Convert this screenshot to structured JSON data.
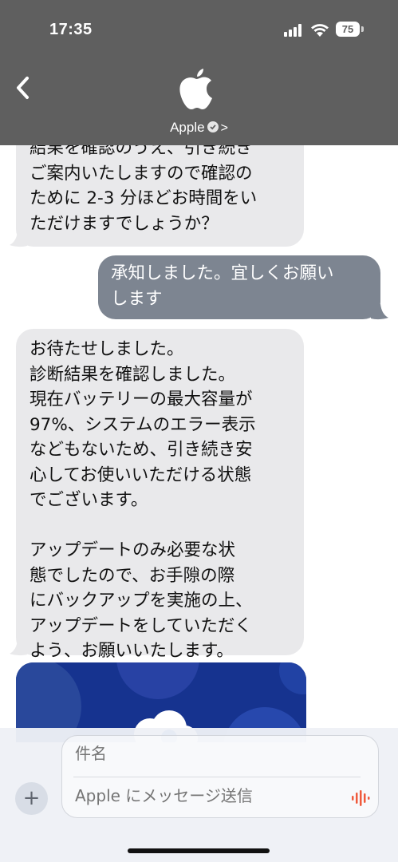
{
  "status_bar": {
    "time": "17:35",
    "battery": "75"
  },
  "header": {
    "contact_name": "Apple",
    "chevron": ">"
  },
  "messages": [
    {
      "from": "received",
      "text": "結果を確認のうえ、引き続き\nご案内いたしますので確認の\nために 2-3 分ほどお時間をい\nただけますでしょうか？"
    },
    {
      "from": "sent",
      "text": "承知しました。宜しくお願い\nします"
    },
    {
      "from": "received",
      "text": "お待たせしました。\n診断結果を確認しました。\n現在バッテリーの最大容量が\n97%、システムのエラー表示\nなどもないため、引き続き安\n心してお使いいただける状態\nでございます。\n\nアップデートのみ必要な状\n態でしたので、お手隙の際\nにバックアップを実施の上、\nアップデートをしていただく\nよう、お願いいたします。"
    }
  ],
  "composer": {
    "subject_placeholder": "件名",
    "message_placeholder": "Apple にメッセージ送信",
    "plus": "+"
  },
  "colors": {
    "header_bg": "#5f5f5f",
    "received_bubble": "#e9e9eb",
    "sent_bubble": "#7d8591",
    "voice_accent": "#ef5a3c",
    "card_bg": "#16338f"
  },
  "icons": [
    "signal-icon",
    "wifi-icon",
    "battery-icon",
    "back-chevron-icon",
    "apple-logo-icon",
    "verified-badge-icon",
    "plus-icon",
    "voice-waveform-icon",
    "cloud-icon"
  ]
}
